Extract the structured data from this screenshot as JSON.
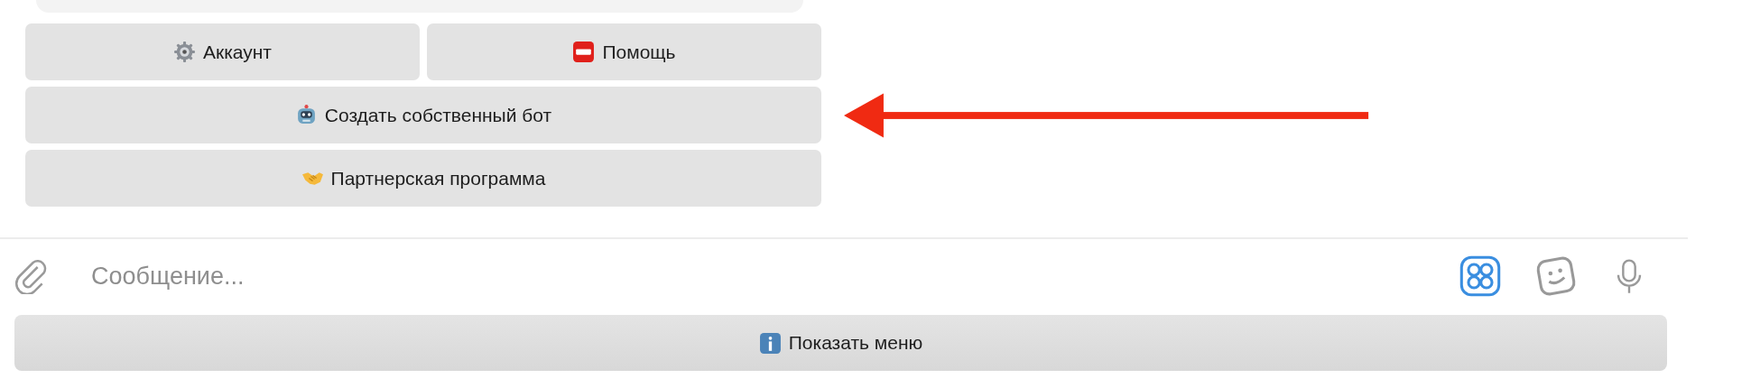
{
  "keyboard": {
    "rows": [
      [
        {
          "label": "Аккаунт",
          "kind": "gear"
        },
        {
          "label": "Помощь",
          "kind": "sos"
        }
      ],
      [
        {
          "label": "Создать собственный бот",
          "kind": "robot"
        }
      ],
      [
        {
          "label": "Партнерская программа",
          "kind": "handshake"
        }
      ]
    ]
  },
  "composer": {
    "placeholder": "Сообщение..."
  },
  "menu_button": {
    "label": "Показать меню",
    "kind": "info"
  }
}
